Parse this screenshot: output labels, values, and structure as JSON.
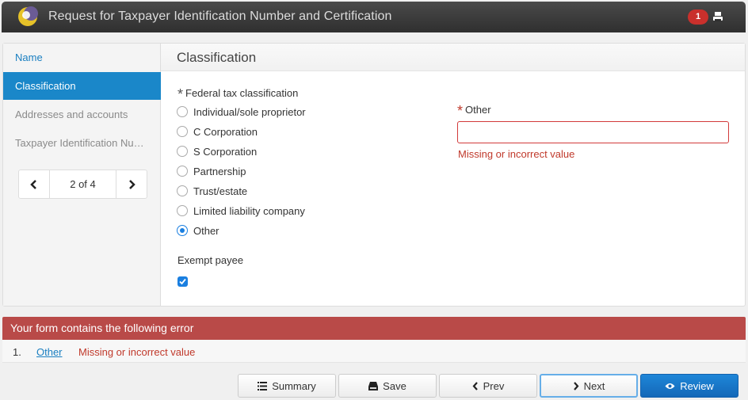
{
  "header": {
    "title": "Request for Taxpayer Identification Number and Certification",
    "error_count": "1"
  },
  "sidebar": {
    "items": [
      {
        "label": "Name"
      },
      {
        "label": "Classification"
      },
      {
        "label": "Addresses and accounts"
      },
      {
        "label": "Taxpayer Identification Nu…"
      }
    ],
    "pager": "2 of 4"
  },
  "section": {
    "title": "Classification"
  },
  "form": {
    "required_mark": "*",
    "classification_label": "Federal tax classification",
    "options": [
      {
        "label": "Individual/sole proprietor"
      },
      {
        "label": "C Corporation"
      },
      {
        "label": "S Corporation"
      },
      {
        "label": "Partnership"
      },
      {
        "label": "Trust/estate"
      },
      {
        "label": "Limited liability company"
      },
      {
        "label": "Other"
      }
    ],
    "selected_option": "Other",
    "exempt_label": "Exempt payee",
    "exempt_checked": true,
    "other_label": "Other",
    "other_value": "",
    "other_error": "Missing or incorrect value"
  },
  "errors": {
    "banner": "Your form contains the following error",
    "items": [
      {
        "number": "1.",
        "field": "Other",
        "message": "Missing or incorrect value"
      }
    ]
  },
  "actions": {
    "summary": "Summary",
    "save": "Save",
    "prev": "Prev",
    "next": "Next",
    "review": "Review"
  },
  "colors": {
    "accent": "#1a87c9",
    "error": "#b94a48",
    "review": "#1468b8"
  }
}
